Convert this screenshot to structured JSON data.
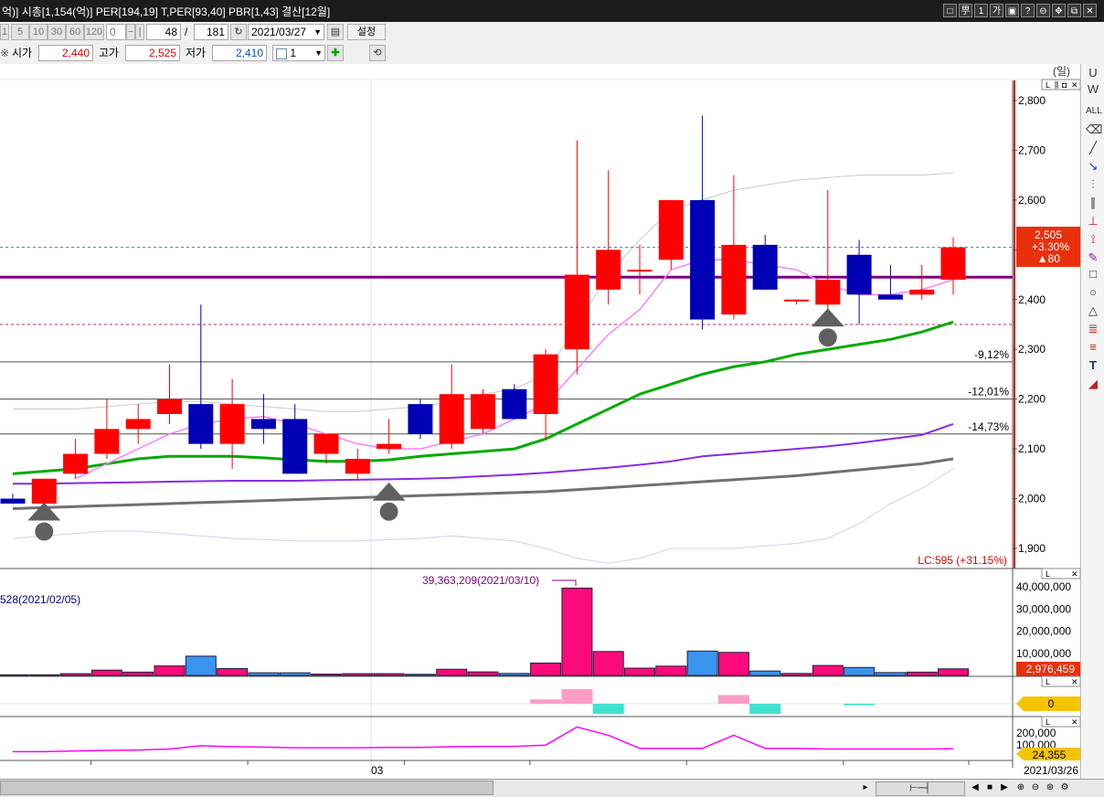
{
  "title_bar": {
    "text": "억)] 시총[1,154(억)] PER[194,19] T,PER[93,40] PBR[1,43] 결산[12월]"
  },
  "window_buttons": [
    "□",
    "甼",
    "1",
    "가",
    "▣",
    "?",
    "⊖",
    "✥",
    "⧉",
    "✕"
  ],
  "toolbar": {
    "periods": [
      "1",
      "5",
      "10",
      "30",
      "60",
      "120"
    ],
    "period_input": "0",
    "display_count": "48",
    "total_count": "181",
    "slash": "/",
    "date": "2021/03/27",
    "setting_label": "설정"
  },
  "price_row": {
    "open_label": "시가",
    "open_value": "2,440",
    "high_label": "고가",
    "high_value": "2,525",
    "low_label": "저가",
    "low_value": "2,410",
    "ratio_value": "1"
  },
  "price_panel": {
    "unit_label": "(일)",
    "y_ticks": [
      "2,800",
      "2,700",
      "2,600",
      "2,500",
      "2,400",
      "2,300",
      "2,200",
      "2,100",
      "2,000",
      "1,900"
    ],
    "current_price": "2,505",
    "change_pct": "+3.30%",
    "change_abs": "▲80",
    "levels": [
      "-9,12%",
      "-12,01%",
      "-14,73%"
    ],
    "lc_label": "LC:595 (+31.15%)",
    "colors": {
      "up": "#ff0000",
      "down": "#0000b4",
      "ma5": "#ff80ff",
      "ma20": "#00aa00",
      "ma60": "#8a2be2",
      "ma120": "#707070",
      "hline": "#800080"
    }
  },
  "volume_panel": {
    "max_label": "39,363,209(2021/03/10)",
    "left_label": "528(2021/02/05)",
    "y_ticks": [
      "40,000,000",
      "30,000,000",
      "20,000,000",
      "10,000,000"
    ],
    "current": "2,976,459"
  },
  "osc_panel": {
    "current": "0"
  },
  "obv_panel": {
    "y_ticks": [
      "200,000",
      "100,000"
    ],
    "current": "24,355"
  },
  "x_axis": {
    "month_label": "03",
    "end_date": "2021/03/26"
  },
  "chart_data": {
    "type": "candlestick",
    "candles": [
      {
        "o": 2000,
        "h": 2010,
        "l": 1990,
        "c": 1990
      },
      {
        "o": 1990,
        "h": 2040,
        "l": 1980,
        "c": 2040
      },
      {
        "o": 2050,
        "h": 2120,
        "l": 2040,
        "c": 2090
      },
      {
        "o": 2090,
        "h": 2200,
        "l": 2080,
        "c": 2140
      },
      {
        "o": 2140,
        "h": 2190,
        "l": 2110,
        "c": 2160
      },
      {
        "o": 2170,
        "h": 2270,
        "l": 2150,
        "c": 2200
      },
      {
        "o": 2190,
        "h": 2390,
        "l": 2100,
        "c": 2110
      },
      {
        "o": 2110,
        "h": 2240,
        "l": 2060,
        "c": 2190
      },
      {
        "o": 2160,
        "h": 2210,
        "l": 2110,
        "c": 2140
      },
      {
        "o": 2160,
        "h": 2190,
        "l": 2050,
        "c": 2050
      },
      {
        "o": 2090,
        "h": 2130,
        "l": 2070,
        "c": 2130
      },
      {
        "o": 2050,
        "h": 2100,
        "l": 2040,
        "c": 2080
      },
      {
        "o": 2100,
        "h": 2160,
        "l": 2090,
        "c": 2110
      },
      {
        "o": 2190,
        "h": 2200,
        "l": 2120,
        "c": 2130
      },
      {
        "o": 2110,
        "h": 2270,
        "l": 2100,
        "c": 2210
      },
      {
        "o": 2140,
        "h": 2220,
        "l": 2130,
        "c": 2210
      },
      {
        "o": 2220,
        "h": 2230,
        "l": 2160,
        "c": 2160
      },
      {
        "o": 2170,
        "h": 2300,
        "l": 2120,
        "c": 2290
      },
      {
        "o": 2300,
        "h": 2720,
        "l": 2250,
        "c": 2450
      },
      {
        "o": 2420,
        "h": 2660,
        "l": 2390,
        "c": 2500
      },
      {
        "o": 2460,
        "h": 2510,
        "l": 2410,
        "c": 2460
      },
      {
        "o": 2480,
        "h": 2600,
        "l": 2460,
        "c": 2600
      },
      {
        "o": 2600,
        "h": 2770,
        "l": 2340,
        "c": 2360
      },
      {
        "o": 2370,
        "h": 2650,
        "l": 2360,
        "c": 2510
      },
      {
        "o": 2510,
        "h": 2530,
        "l": 2420,
        "c": 2420
      },
      {
        "o": 2400,
        "h": 2400,
        "l": 2390,
        "c": 2400
      },
      {
        "o": 2390,
        "h": 2620,
        "l": 2380,
        "c": 2440
      },
      {
        "o": 2490,
        "h": 2520,
        "l": 2350,
        "c": 2410
      },
      {
        "o": 2410,
        "h": 2470,
        "l": 2400,
        "c": 2400
      },
      {
        "o": 2410,
        "h": 2470,
        "l": 2400,
        "c": 2420
      },
      {
        "o": 2440,
        "h": 2525,
        "l": 2410,
        "c": 2505
      }
    ],
    "volume": [
      0.3,
      0.3,
      0.8,
      2.4,
      1.5,
      4.3,
      8.7,
      3.1,
      1.2,
      1.2,
      0.6,
      0.8,
      0.8,
      0.5,
      2.8,
      1.6,
      0.9,
      5.6,
      39.4,
      10.8,
      3.3,
      4.2,
      11.0,
      10.4,
      2.0,
      0.9,
      4.5,
      3.6,
      1.3,
      1.5,
      2.976
    ],
    "ma5": [
      null,
      null,
      2040,
      2070,
      2100,
      2130,
      2150,
      2160,
      2165,
      2150,
      2130,
      2110,
      2100,
      2100,
      2115,
      2130,
      2160,
      2190,
      2260,
      2330,
      2380,
      2460,
      2480,
      2480,
      2470,
      2460,
      2430,
      2410,
      2410,
      2420,
      2440
    ],
    "ma20": [
      2050,
      2055,
      2060,
      2070,
      2080,
      2085,
      2085,
      2085,
      2082,
      2078,
      2075,
      2075,
      2078,
      2085,
      2090,
      2095,
      2100,
      2120,
      2150,
      2180,
      2210,
      2230,
      2250,
      2265,
      2275,
      2290,
      2300,
      2310,
      2320,
      2335,
      2355
    ],
    "ma60": [
      2030,
      2030,
      2031,
      2032,
      2033,
      2034,
      2035,
      2036,
      2036,
      2036,
      2037,
      2038,
      2039,
      2040,
      2042,
      2045,
      2048,
      2052,
      2057,
      2062,
      2068,
      2075,
      2085,
      2090,
      2095,
      2100,
      2105,
      2112,
      2120,
      2128,
      2150
    ],
    "ma120": [
      1980,
      1982,
      1984,
      1986,
      1988,
      1990,
      1992,
      1994,
      1996,
      1998,
      2000,
      2002,
      2004,
      2006,
      2008,
      2010,
      2012,
      2014,
      2018,
      2022,
      2026,
      2030,
      2034,
      2038,
      2042,
      2046,
      2052,
      2058,
      2064,
      2070,
      2080
    ],
    "bb_upper": [
      2180,
      2180,
      2180,
      2185,
      2190,
      2195,
      2195,
      2190,
      2185,
      2180,
      2175,
      2175,
      2180,
      2185,
      2195,
      2210,
      2220,
      2250,
      2350,
      2450,
      2520,
      2580,
      2600,
      2620,
      2630,
      2640,
      2645,
      2650,
      2650,
      2650,
      2655
    ],
    "bb_lower": [
      1920,
      1925,
      1930,
      1935,
      1935,
      1930,
      1925,
      1920,
      1918,
      1915,
      1915,
      1915,
      1918,
      1920,
      1925,
      1920,
      1915,
      1900,
      1880,
      1870,
      1880,
      1900,
      1900,
      1900,
      1905,
      1910,
      1920,
      1950,
      1990,
      2020,
      2060
    ],
    "osc": [
      0,
      0,
      0,
      0,
      0,
      0,
      0,
      0,
      0,
      0,
      0,
      0,
      0,
      0,
      0,
      0,
      0,
      0.3,
      1.0,
      -0.7,
      0,
      0,
      0,
      0.6,
      -0.7,
      0,
      0,
      -0.1,
      0,
      0,
      0
    ],
    "obv": [
      10,
      10,
      12,
      14,
      15,
      18,
      28,
      25,
      24,
      22,
      22,
      22,
      23,
      23,
      25,
      26,
      26,
      30,
      85,
      60,
      20,
      20,
      20,
      60,
      20,
      20,
      18,
      18,
      18,
      18,
      19
    ],
    "hline": 2445,
    "dashed_blue": 2505,
    "dashed_pink": 2350,
    "levels": [
      2275,
      2200,
      2130
    ],
    "ylim": [
      1870,
      2830
    ]
  }
}
